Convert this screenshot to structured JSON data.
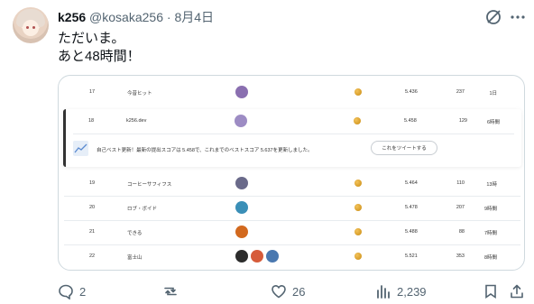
{
  "author": {
    "name": "k256",
    "handle": "@kosaka256",
    "separator": "·",
    "date": "8月4日"
  },
  "tweet": {
    "text": "ただいま。\nあと48時間！"
  },
  "card": {
    "rows_top": [
      {
        "rank": "17",
        "name": "今昔ヒット",
        "score": "5.436",
        "count": "237",
        "time": "1日",
        "langs": [
          "#8a6fb0"
        ]
      }
    ],
    "highlight_row": {
      "rank": "18",
      "name": "k256.dev",
      "score": "5.458",
      "count": "129",
      "time": "6時間",
      "langs": [
        "#9d8cc4"
      ]
    },
    "notice": "自己ベスト更新！最新の提出スコアは 5.458で、これまでのベストスコア 5.637を更新しました。",
    "tweet_button": "これをツイートする",
    "rows_bottom": [
      {
        "rank": "19",
        "name": "コーヒーサフィフス",
        "score": "5.464",
        "count": "110",
        "time": "13時",
        "langs": [
          "#6a6a8a"
        ]
      },
      {
        "rank": "20",
        "name": "ロブ・ボイド",
        "score": "5.478",
        "count": "207",
        "time": "9時間",
        "langs": [
          "#3a8fb7"
        ]
      },
      {
        "rank": "21",
        "name": "できる",
        "score": "5.488",
        "count": "88",
        "time": "7時間",
        "langs": [
          "#d2691e"
        ]
      },
      {
        "rank": "22",
        "name": "富士山",
        "score": "5.521",
        "count": "353",
        "time": "8時間",
        "langs": [
          "#2c2c2c",
          "#d65b3a",
          "#4a78b0"
        ]
      }
    ]
  },
  "actions": {
    "reply_count": "2",
    "retweet_count": "",
    "like_count": "26",
    "view_count": "2,239"
  },
  "colors": {
    "secondary_text": "#536471",
    "primary_text": "#0f1419",
    "border": "#cfd9de"
  }
}
